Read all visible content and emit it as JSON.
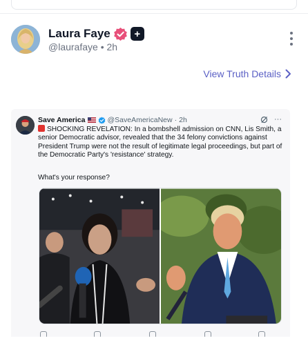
{
  "author": {
    "display_name": "Laura Faye",
    "handle": "@laurafaye",
    "separator": "•",
    "time": "2h",
    "verified_color": "#e8507a",
    "plus_badge": "+"
  },
  "link": {
    "view_details": "View Truth Details"
  },
  "embedded_post": {
    "name": "Save America",
    "handle": "@SaveAmericaNew",
    "separator": "·",
    "time": "2h",
    "more": "···",
    "text": "SHOCKING REVELATION: In a bombshell admission on CNN, Lis Smith, a senior Democratic advisor, revealed that the 34 felony convictions against President Trump were not the result of legitimate legal proceedings, but part of the Democratic Party's 'resistance' strategy.",
    "question": "What's your response?"
  },
  "icons": {
    "verified": "verified-badge-icon",
    "plus": "plus-badge-icon",
    "more": "more-vertical-icon",
    "chevron": "chevron-right-icon",
    "flag": "us-flag-icon",
    "check": "blue-check-icon",
    "grok": "grok-icon",
    "siren": "siren-emoji-icon"
  },
  "colors": {
    "link": "#5b60c5",
    "verified_pink": "#e8507a",
    "twitter_blue": "#1d9bf0"
  }
}
